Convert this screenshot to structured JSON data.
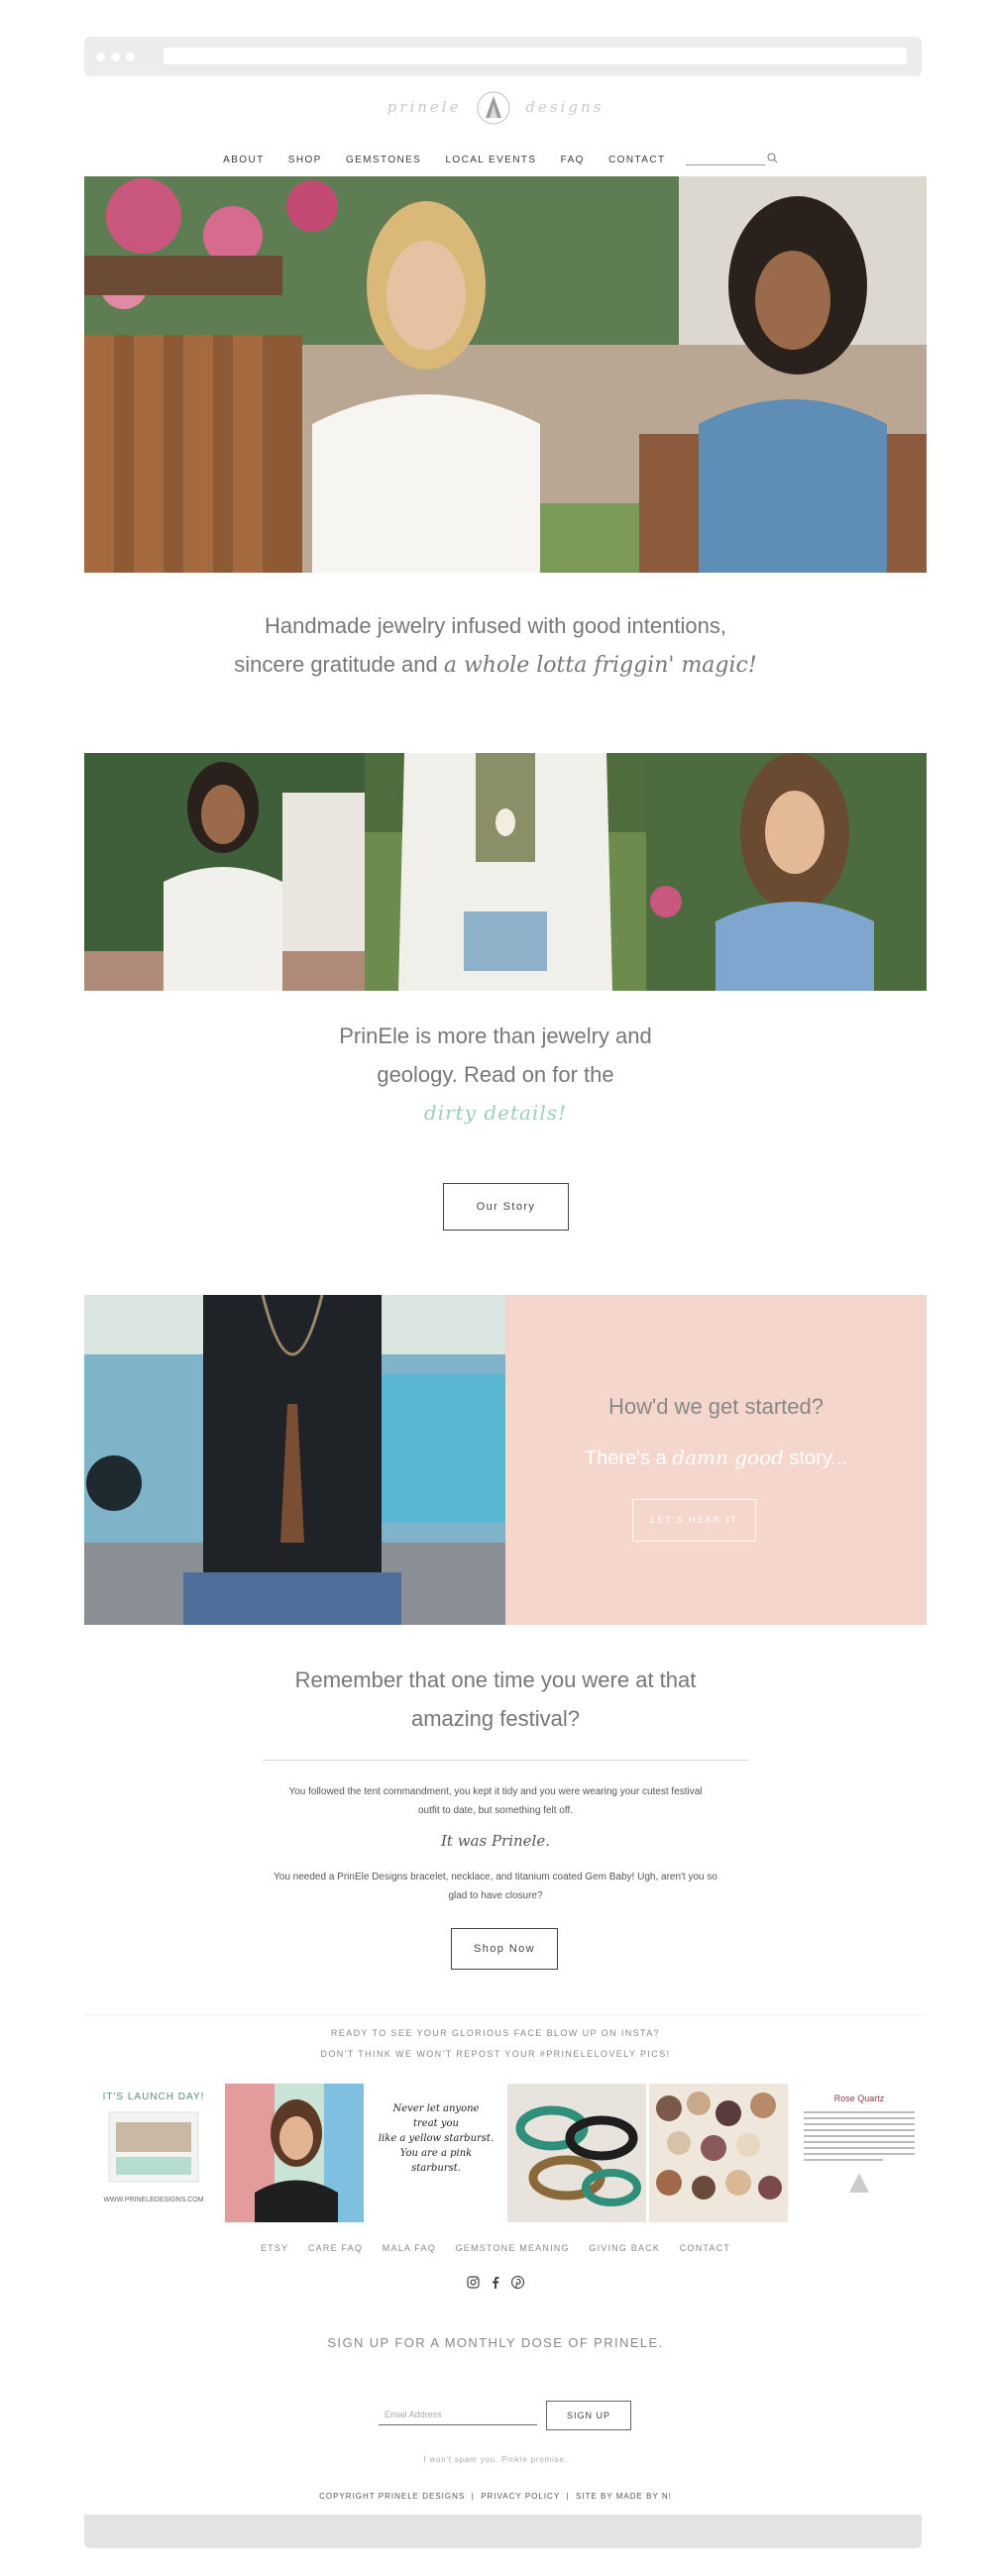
{
  "colors": {
    "pink_panel": "#f4d6cd",
    "teal_script": "#9ccdbe",
    "nav_text": "#3a3a3a",
    "body_text": "#777777"
  },
  "brand": {
    "logo_text_left": "prinele",
    "logo_text_right": "designs"
  },
  "nav": {
    "items": [
      "ABOUT",
      "SHOP",
      "GEMSTONES",
      "LOCAL EVENTS",
      "FAQ",
      "CONTACT"
    ],
    "search_icon": "search-icon"
  },
  "intro": {
    "line1": "Handmade jewelry infused with good intentions,",
    "line2_plain": "sincere gratitude and ",
    "line2_script": "a whole lotta friggin' magic!"
  },
  "story": {
    "line1": "PrinEle is more than jewelry and",
    "line2": "geology. Read on for the",
    "script": "dirty details!",
    "button": "Our Story"
  },
  "started": {
    "question": "How'd we get started?",
    "line_plain_1": "There's a ",
    "line_italic": "damn good",
    "line_plain_2": " story...",
    "button": "LET'S HEAR IT"
  },
  "festival": {
    "heading_line1": "Remember that one time you were at that",
    "heading_line2": "amazing festival?",
    "para1_line1": "You followed the tent commandment, you kept it tidy and you were wearing your cutest festival",
    "para1_line2": "outfit to date, but something felt off.",
    "script": "It was Prinele.",
    "para2_line1": "You needed a PrinEle Designs bracelet, necklace, and titanium coated Gem Baby! Ugh, aren't you so",
    "para2_line2": "glad to have closure?",
    "button": "Shop Now"
  },
  "insta": {
    "line1": "READY TO SEE YOUR GLORIOUS FACE BLOW UP ON INSTA?",
    "line2": "DON'T THINK WE WON'T REPOST YOUR #PRINELELOVELY PICS!",
    "thumbs": {
      "launch_title": "IT'S LAUNCH DAY!",
      "launch_url": "WWW.PRINELEDESIGNS.COM",
      "quote_line1": "Never let anyone",
      "quote_line2": "treat you",
      "quote_line3": "like a yellow starburst.",
      "quote_line4": "You are a pink",
      "quote_line5": "starburst.",
      "rose_title": "Rose Quartz"
    }
  },
  "footer": {
    "links": [
      "ETSY",
      "CARE FAQ",
      "MALA FAQ",
      "GEMSTONE MEANING",
      "GIVING BACK",
      "CONTACT"
    ],
    "social": [
      "instagram-icon",
      "facebook-icon",
      "pinterest-icon"
    ],
    "signup_heading": "SIGN UP FOR A MONTHLY DOSE OF PRINELE.",
    "email_placeholder": "Email Address",
    "signup_button": "SIGN UP",
    "no_spam": "I won't spam you. Pinkie promise.",
    "copyright": "COPYRIGHT PRINELE DESIGNS",
    "privacy": "PRIVACY POLICY",
    "credit": "SITE BY MADE BY N!",
    "separator": "|"
  }
}
